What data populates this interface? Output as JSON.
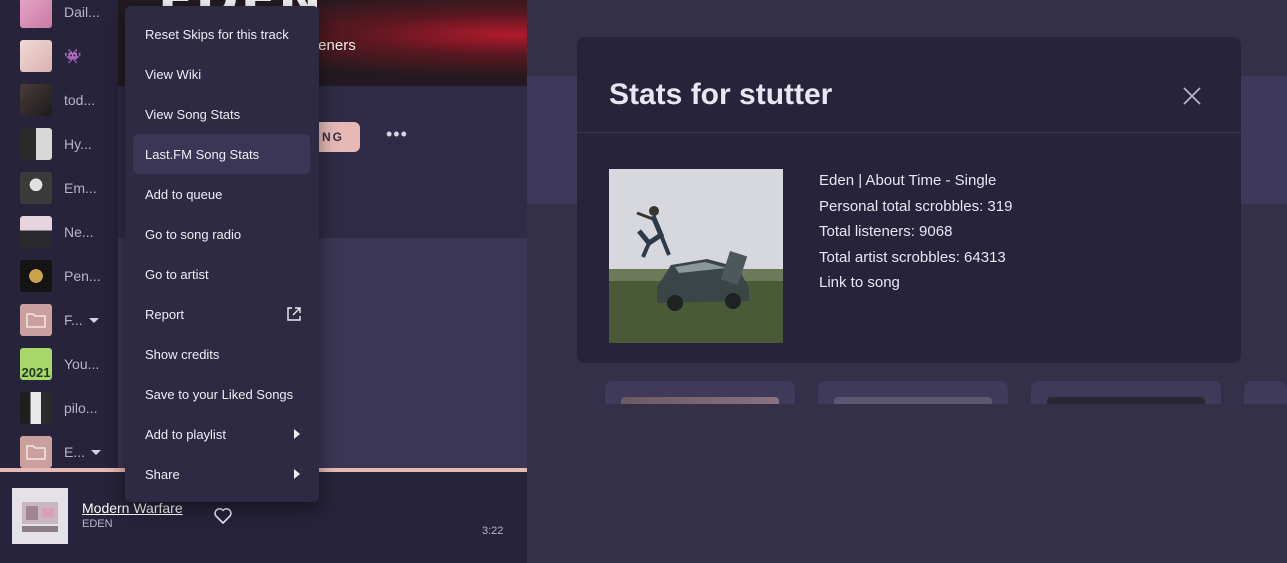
{
  "sidebar": {
    "items": [
      {
        "label": "Dail...",
        "icon": "playlist-thumb"
      },
      {
        "label": "👾",
        "icon": "playlist-thumb"
      },
      {
        "label": "tod...",
        "icon": "playlist-thumb"
      },
      {
        "label": "Hy...",
        "icon": "playlist-thumb"
      },
      {
        "label": "Em...",
        "icon": "playlist-thumb"
      },
      {
        "label": "Ne...",
        "icon": "playlist-thumb"
      },
      {
        "label": "Pen...",
        "icon": "playlist-thumb"
      },
      {
        "label": "F...",
        "icon": "folder-icon"
      },
      {
        "label": "You...",
        "icon": "playlist-thumb",
        "thumb_text": "2021"
      },
      {
        "label": "pilo...",
        "icon": "playlist-thumb"
      },
      {
        "label": "E...",
        "icon": "folder-icon"
      }
    ]
  },
  "artist_header": {
    "name": "EDEN",
    "listeners_fragment": "teners",
    "follow_fragment": "NG",
    "more_label": "•••"
  },
  "context_menu": {
    "items": [
      {
        "label": "Reset Skips for this track"
      },
      {
        "label": "View Wiki"
      },
      {
        "label": "View Song Stats"
      },
      {
        "label": "Last.FM Song Stats",
        "active": true
      },
      {
        "label": "Add to queue"
      },
      {
        "label": "Go to song radio"
      },
      {
        "label": "Go to artist"
      },
      {
        "label": "Report",
        "icon": "external-link-icon"
      },
      {
        "label": "Show credits"
      },
      {
        "label": "Save to your Liked Songs"
      },
      {
        "label": "Add to playlist",
        "submenu": true
      },
      {
        "label": "Share",
        "submenu": true
      }
    ]
  },
  "stats_modal": {
    "title": "Stats for stutter",
    "lines": [
      "Eden | About Time - Single",
      "Personal total scrobbles: 319",
      "Total listeners: 9068",
      "Total artist scrobbles: 64313",
      "Link to song"
    ]
  },
  "now_playing": {
    "title": "Modern Warfare",
    "artist": "EDEN",
    "time": "3:22",
    "progress": 1.0
  },
  "colors": {
    "accent": "#e6b9b4",
    "panel": "#26233a",
    "menu": "#2e2a44",
    "background": "#35304a"
  }
}
